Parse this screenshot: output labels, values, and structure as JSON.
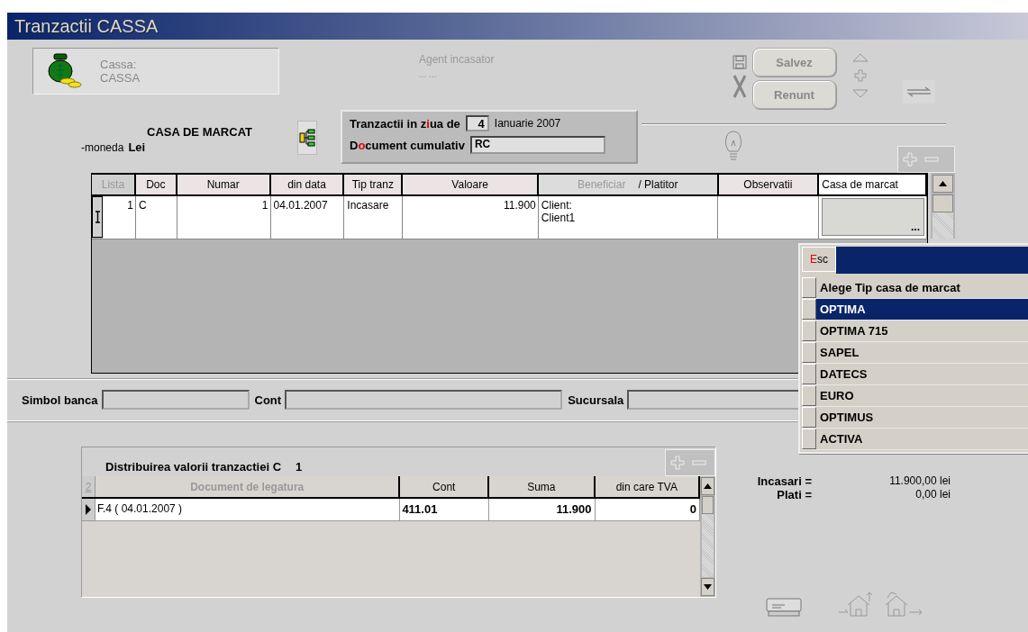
{
  "window": {
    "title": "Tranzactii CASSA"
  },
  "cassa": {
    "label": "Cassa:",
    "value": "CASSA"
  },
  "agent": {
    "label": "Agent incasator",
    "value": "... ..."
  },
  "buttons": [
    {
      "label": "Salvez"
    },
    {
      "label": "Renunt"
    }
  ],
  "register": {
    "title": "CASA DE MARCAT",
    "currency_label": "-moneda",
    "currency": "Lei"
  },
  "day_panel": {
    "day_label": [
      {
        "text": "Tranzactii in z",
        "hot": false
      },
      {
        "text": "i",
        "hot": true
      },
      {
        "text": "ua de",
        "hot": false
      }
    ],
    "day": "4",
    "month_year": "Ianuarie 2007",
    "doc_label": [
      {
        "text": "D",
        "hot": false
      },
      {
        "text": "o",
        "hot": true
      },
      {
        "text": "cument cumulativ",
        "hot": false
      }
    ],
    "doc_value": "RC"
  },
  "table": {
    "columns": [
      {
        "parts": [
          {
            "text": "Lista",
            "dim": true
          }
        ],
        "selected": false
      },
      {
        "parts": [
          {
            "text": "Doc",
            "dim": false
          }
        ],
        "selected": false
      },
      {
        "parts": [
          {
            "text": "Numar",
            "dim": false
          }
        ],
        "selected": false
      },
      {
        "parts": [
          {
            "text": "din data",
            "dim": false
          }
        ],
        "selected": false
      },
      {
        "parts": [
          {
            "text": "Tip tranz",
            "dim": false
          }
        ],
        "selected": false
      },
      {
        "parts": [
          {
            "text": "Valoare",
            "dim": false
          }
        ],
        "selected": false
      },
      {
        "parts": [
          {
            "text": "Beneficiar",
            "dim": true
          },
          {
            "text": "/  Platitor",
            "dim": false
          }
        ],
        "selected": false
      },
      {
        "parts": [
          {
            "text": "Observatii",
            "dim": false
          }
        ],
        "selected": false
      },
      {
        "parts": [
          {
            "text": "Casa de marcat",
            "dim": false
          }
        ],
        "selected": true
      }
    ],
    "rows": [
      {
        "lista": "1",
        "doc": "C",
        "numar": "1",
        "din_data": "04.01.2007",
        "tip_tranz": "Incasare",
        "valoare": "11.900",
        "beneficiar": [
          "Client:",
          "Client1"
        ],
        "picker": "..."
      }
    ]
  },
  "bank_fields": [
    {
      "label": "Simbol banca"
    },
    {
      "label": "Cont"
    },
    {
      "label": "Sucursala"
    }
  ],
  "distribution": {
    "title": "Distribuirea valorii tranzactiei C",
    "number": "1",
    "corner": "2",
    "columns": [
      {
        "label": "Document de legatura",
        "dim": true
      },
      {
        "label": "Cont",
        "dim": false
      },
      {
        "label": "Suma",
        "dim": false
      },
      {
        "label": "din care TVA",
        "dim": false
      }
    ],
    "rows": [
      {
        "document": "F.4 ( 04.01.2007 )",
        "cont": "411.01",
        "suma": "11.900",
        "tva": "0"
      }
    ]
  },
  "totals": [
    {
      "label": "Incasari =",
      "value": "11.900,00 lei"
    },
    {
      "label": "Plati =",
      "value": "0,00 lei"
    }
  ],
  "popup": {
    "esc": [
      {
        "text": "E",
        "hot": true
      },
      {
        "text": "sc",
        "hot": false
      }
    ],
    "header": "Alege Tip casa de marcat",
    "items": [
      {
        "label": "OPTIMA",
        "selected": true
      },
      {
        "label": "OPTIMA 715",
        "selected": false
      },
      {
        "label": "SAPEL",
        "selected": false
      },
      {
        "label": "DATECS",
        "selected": false
      },
      {
        "label": "EURO",
        "selected": false
      },
      {
        "label": "OPTIMUS",
        "selected": false
      },
      {
        "label": "ACTIVA",
        "selected": false
      }
    ]
  }
}
